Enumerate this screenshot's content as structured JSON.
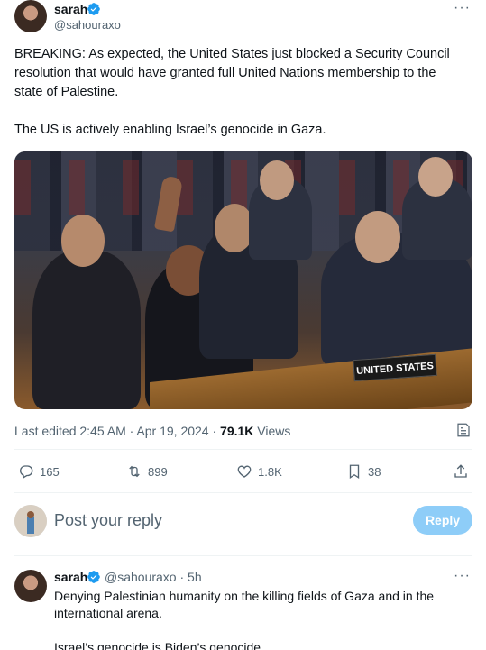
{
  "tweet": {
    "author_name": "sarah",
    "author_handle": "@sahouraxo",
    "more_label": "···",
    "text": "BREAKING: As expected, the United States just blocked a Security Council resolution that would have granted full United Nations membership to the state of Palestine.\n\nThe US is actively enabling Israel’s genocide in Gaza.",
    "photo": {
      "nameplate_text": "UNITED STATES"
    },
    "meta": {
      "edited": "Last edited 2:45 AM · Apr 19, 2024 · ",
      "views_count": "79.1K",
      "views_label": " Views"
    },
    "actions": {
      "replies": "165",
      "reposts": "899",
      "likes": "1.8K",
      "bookmarks": "38"
    }
  },
  "composer": {
    "placeholder": "Post your reply",
    "reply_button": "Reply"
  },
  "reply_tweet": {
    "author_name": "sarah",
    "author_handle": "@sahouraxo · 5h",
    "more_label": "···",
    "text": "Denying Palestinian humanity on the killing fields of Gaza and in the international arena.\n\nIsrael’s genocide is Biden’s genocide."
  },
  "colors": {
    "accent": "#1d9bf0",
    "reply_button_disabled": "#8ecdf8",
    "secondary_text": "#536471",
    "primary_text": "#0f1419"
  }
}
